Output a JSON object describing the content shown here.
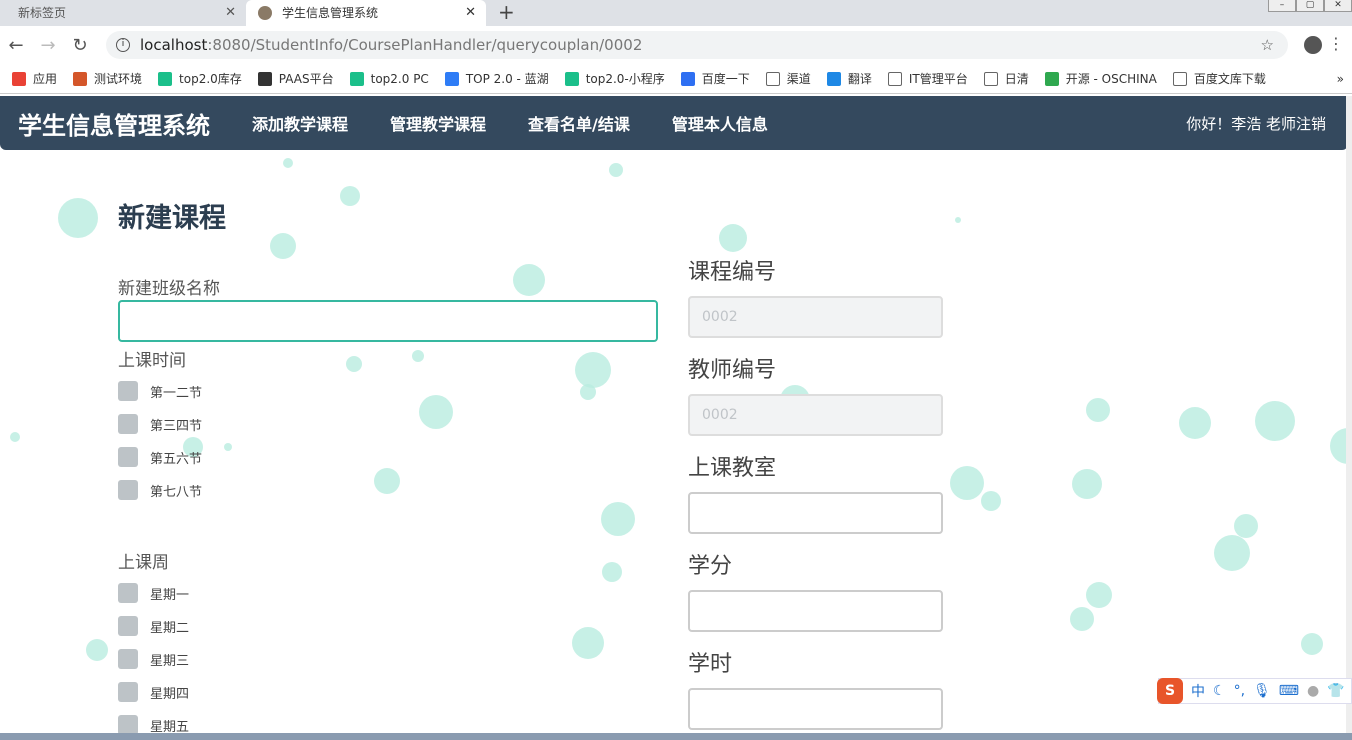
{
  "browser": {
    "tabs": [
      {
        "title": "新标签页"
      },
      {
        "title": "学生信息管理系统"
      }
    ],
    "url_host": "localhost",
    "url_rest": ":8080/StudentInfo/CoursePlanHandler/querycouplan/0002",
    "bookmarks": [
      {
        "label": "应用",
        "color": "#e94235"
      },
      {
        "label": "测试环境",
        "color": "#d4562a"
      },
      {
        "label": "top2.0库存",
        "color": "#1bbf8a"
      },
      {
        "label": "PAAS平台",
        "color": "#333333"
      },
      {
        "label": "top2.0 PC",
        "color": "#1bbf8a"
      },
      {
        "label": "TOP 2.0 - 蓝湖",
        "color": "#2e7cf6"
      },
      {
        "label": "top2.0-小程序",
        "color": "#1bbf8a"
      },
      {
        "label": "百度一下",
        "color": "#2e6ff2"
      },
      {
        "label": "渠道",
        "color": "#ffffff"
      },
      {
        "label": "翻译",
        "color": "#1e88e5"
      },
      {
        "label": "IT管理平台",
        "color": "#ffffff"
      },
      {
        "label": "日清",
        "color": "#ffffff"
      },
      {
        "label": "开源 - OSCHINA",
        "color": "#2fa84f"
      },
      {
        "label": "百度文库下载",
        "color": "#ffffff"
      }
    ]
  },
  "navbar": {
    "brand": "学生信息管理系统",
    "links": [
      "添加教学课程",
      "管理教学课程",
      "查看名单/结课",
      "管理本人信息"
    ],
    "user": "你好！李浩 老师注销"
  },
  "form": {
    "title": "新建课程",
    "class_name_label": "新建班级名称",
    "class_name_value": "",
    "time_label": "上课时间",
    "times": [
      "第一二节",
      "第三四节",
      "第五六节",
      "第七八节"
    ],
    "week_label": "上课周",
    "weeks": [
      "星期一",
      "星期二",
      "星期三",
      "星期四",
      "星期五"
    ],
    "course_id_label": "课程编号",
    "course_id_value": "0002",
    "teacher_id_label": "教师编号",
    "teacher_id_value": "0002",
    "room_label": "上课教室",
    "credit_label": "学分",
    "hours_label": "学时"
  },
  "ime": {
    "mode": "中"
  }
}
